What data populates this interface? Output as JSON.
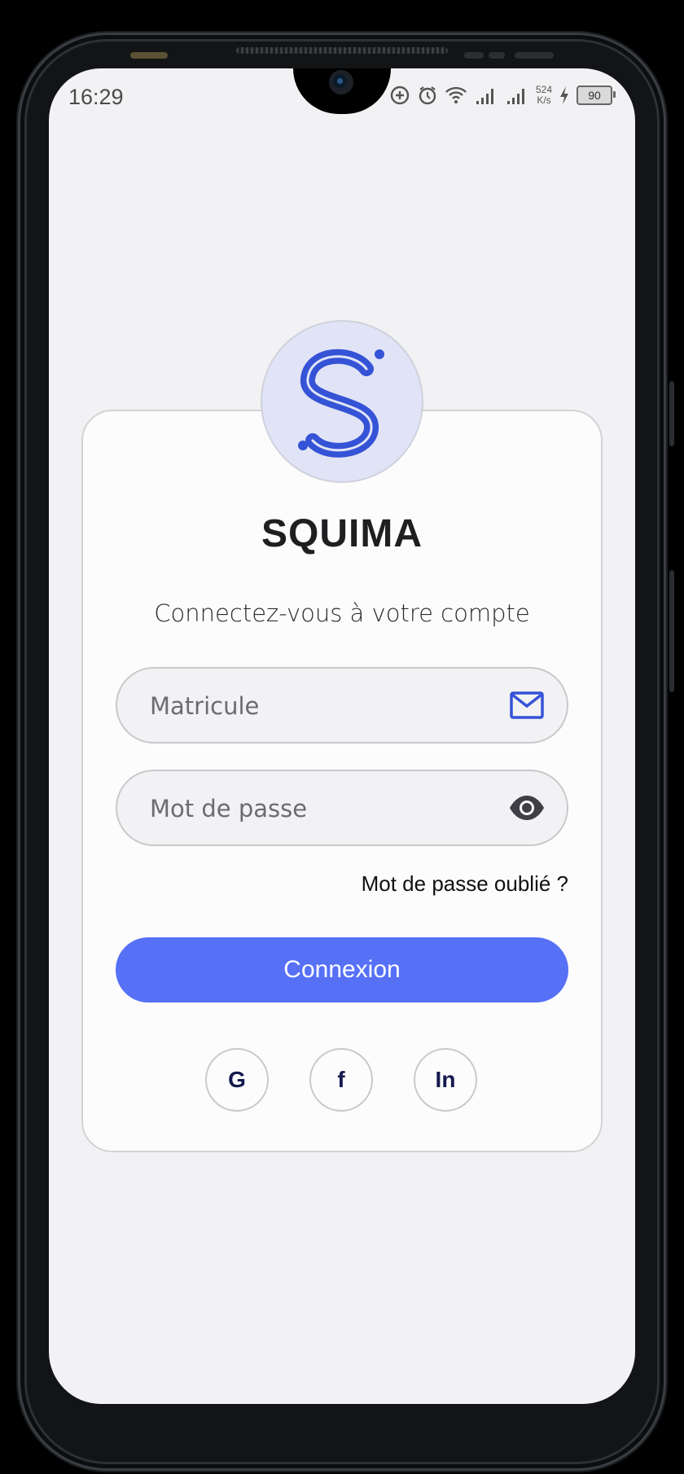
{
  "status_bar": {
    "time": "16:29",
    "net_rate_value": "524",
    "net_rate_unit": "K/s",
    "battery_level": "90",
    "icons": [
      "data-saver-icon",
      "alarm-icon",
      "wifi-icon",
      "signal-icon",
      "signal-icon",
      "charging-icon",
      "battery-icon"
    ]
  },
  "app": {
    "logo_letter": "S",
    "title": "SQUIMA",
    "subtitle": "Connectez-vous à votre compte"
  },
  "form": {
    "matricule_placeholder": "Matricule",
    "matricule_icon": "mail-icon",
    "password_placeholder": "Mot de passe",
    "password_icon": "eye-icon",
    "forgot_label": "Mot de passe oublié ?",
    "submit_label": "Connexion"
  },
  "social": [
    {
      "label": "G"
    },
    {
      "label": "f"
    },
    {
      "label": "In"
    }
  ],
  "colors": {
    "primary": "#5670f6",
    "logo": "#3553d6",
    "background": "#f2f2f4",
    "card": "#fcfcfd"
  }
}
